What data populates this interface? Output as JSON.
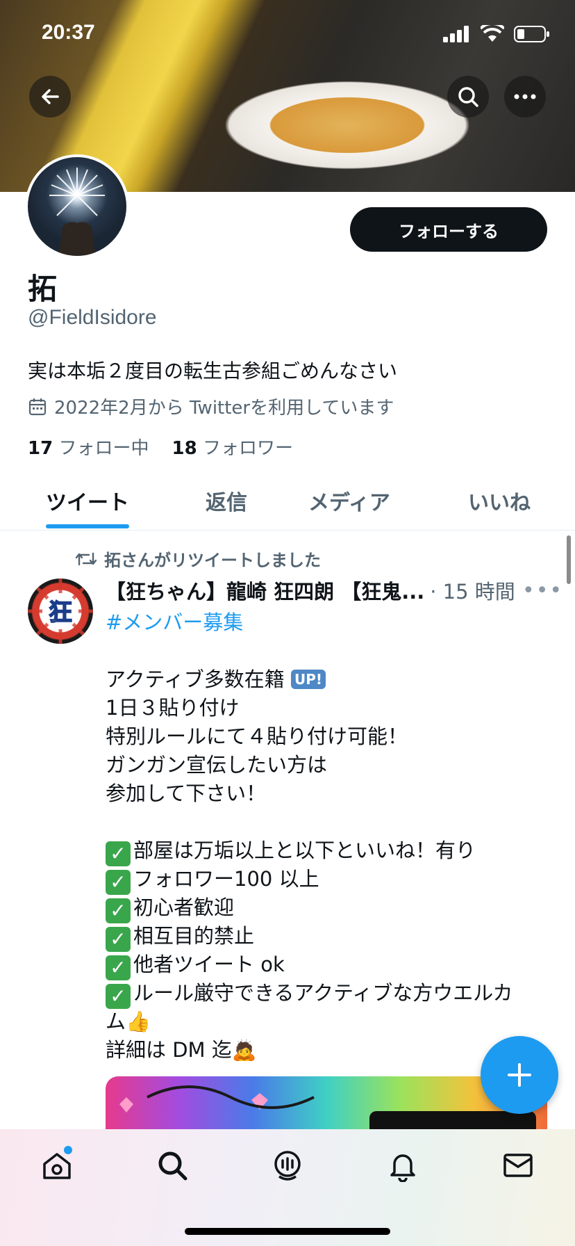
{
  "status_bar": {
    "time": "20:37"
  },
  "profile": {
    "name": "拓",
    "handle": "@FieldIsidore",
    "bio": "実は本垢２度目の転生古参組ごめんなさい",
    "joined": "2022年2月から Twitterを利用しています",
    "following_count": "17",
    "following_label": "フォロー中",
    "followers_count": "18",
    "followers_label": "フォロワー",
    "follow_button": "フォローする"
  },
  "tabs": [
    {
      "label": "ツイート",
      "active": true
    },
    {
      "label": "返信",
      "active": false
    },
    {
      "label": "メディア",
      "active": false
    },
    {
      "label": "いいね",
      "active": false
    }
  ],
  "tweet": {
    "retweet_label": "拓さんがリツイートしました",
    "author_name": "【狂ちゃん】龍崎 狂四朗 【狂鬼...",
    "time": "· 15 時間",
    "hashtag": "#メンバー募集",
    "lines": {
      "l1": "アクティブ多数在籍",
      "l1_badge": "UP!",
      "l2": "1日３貼り付け",
      "l3": "特別ルールにて４貼り付け可能！",
      "l4": "ガンガン宣伝したい方は",
      "l5": "参加して下さい！",
      "c1": "部屋は万垢以上と以下といいね！有り",
      "c2": "フォロワー100 以上",
      "c3": "初心者歓迎",
      "c4": "相互目的禁止",
      "c5": "他者ツイート ok",
      "c6": "ルール厳守できるアクティブな方ウエルカ",
      "c6b": "ム👍",
      "l_last": "詳細は DM 迄🙇"
    }
  },
  "nav": {
    "items": [
      "home-icon",
      "search-icon",
      "spaces-icon",
      "notifications-icon",
      "messages-icon"
    ]
  },
  "colors": {
    "accent": "#1d9bf0",
    "text": "#0f1419",
    "muted": "#536471"
  }
}
